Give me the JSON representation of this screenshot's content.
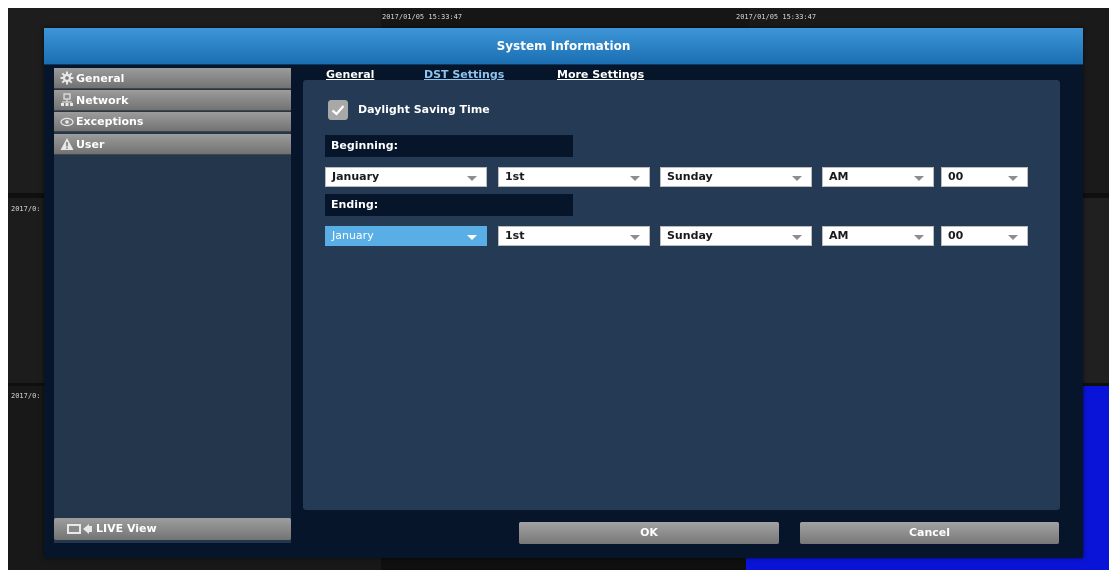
{
  "background": {
    "timestamp_left": "2017/01/05 15:33:47",
    "timestamp_right": "2017/01/05 15:33:47",
    "side_label_1": "2017/0:",
    "side_label_2": "2017/0:"
  },
  "dialog": {
    "title": "System Information"
  },
  "sidebar": {
    "items": [
      {
        "label": "General",
        "icon": "gear-icon"
      },
      {
        "label": "Network",
        "icon": "network-icon"
      },
      {
        "label": "Exceptions",
        "icon": "eye-icon"
      },
      {
        "label": "User",
        "icon": "warning-icon"
      }
    ],
    "live_view_label": "LIVE View"
  },
  "tabs": [
    {
      "label": "General"
    },
    {
      "label": "DST Settings",
      "active": true
    },
    {
      "label": "More Settings"
    }
  ],
  "dst": {
    "checkbox_label": "Daylight Saving Time",
    "checked": true,
    "beginning_label": "Beginning:",
    "ending_label": "Ending:",
    "beginning": {
      "month": "January",
      "week": "1st",
      "day": "Sunday",
      "ampm": "AM",
      "hour": "00"
    },
    "ending": {
      "month": "January",
      "week": "1st",
      "day": "Sunday",
      "ampm": "AM",
      "hour": "00"
    }
  },
  "buttons": {
    "ok": "OK",
    "cancel": "Cancel"
  },
  "colors": {
    "title_bar": "#2a84c8",
    "accent_select": "#5aaee6",
    "panel": "#243a55"
  }
}
